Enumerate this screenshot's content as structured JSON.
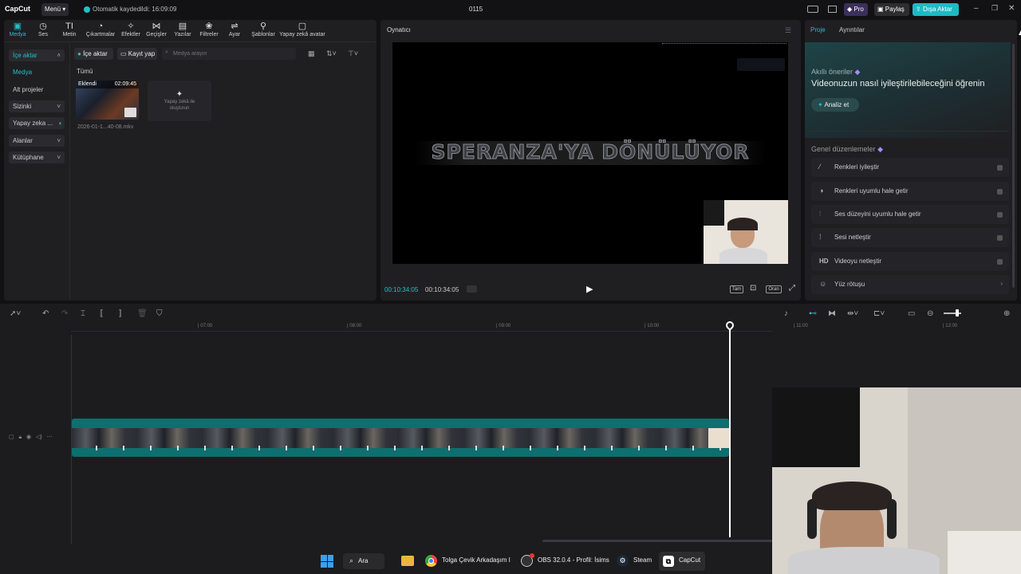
{
  "app": {
    "logo": "CapCut",
    "menu": "Menü",
    "autosave": "Otomatik kaydedildi: 16:09:09",
    "title": "0115",
    "pro": "Pro",
    "share": "Paylaş",
    "export": "Dışa Aktar"
  },
  "toolbar": {
    "items": [
      {
        "label": "Medya",
        "icon": "media-icon"
      },
      {
        "label": "Ses",
        "icon": "audio-icon"
      },
      {
        "label": "Metin",
        "icon": "text-icon"
      },
      {
        "label": "Çıkartmalar",
        "icon": "sticker-icon"
      },
      {
        "label": "Efektler",
        "icon": "effects-icon"
      },
      {
        "label": "Geçişler",
        "icon": "transitions-icon"
      },
      {
        "label": "Yazılar",
        "icon": "captions-icon"
      },
      {
        "label": "Filtreler",
        "icon": "filters-icon"
      },
      {
        "label": "Ayar",
        "icon": "adjust-icon"
      },
      {
        "label": "Şablonlar",
        "icon": "templates-icon"
      },
      {
        "label": "Yapay zekâ avatar",
        "icon": "ai-avatar-icon"
      }
    ]
  },
  "sidebar": {
    "items": [
      "İçe aktar",
      "Medya",
      "Alt projeler",
      "Sizinki",
      "Yapay zeka ...",
      "Alanlar",
      "Kütüphane"
    ]
  },
  "media": {
    "import_btn": "İçe aktar",
    "record_btn": "Kayıt yap",
    "search_placeholder": "Medya arayın",
    "all_label": "Tümü",
    "clip": {
      "badge": "Eklendi",
      "duration": "02:09:45",
      "filename": "2026-01-1...40-08.mkv"
    },
    "ai_create": "Yapay zekâ ile oluşturun"
  },
  "player": {
    "title": "Oynatıcı",
    "overlay_text": "SPERANZA'YA DÖNÜLÜYOR",
    "time_current": "00:10:34:05",
    "time_total": "00:10:34:05",
    "full_btn": "Tam",
    "ratio_btn": "Oran"
  },
  "right_panel": {
    "tab_project": "Proje",
    "tab_details": "Ayrıntılar",
    "smart_title": "Akıllı öneriler",
    "smart_subtitle": "Videonuzun nasıl iyileştirilebileceğini öğrenin",
    "analyze_btn": "Analiz et",
    "general_title": "Genel düzenlemeler",
    "items": [
      "Renkleri iyileştir",
      "Renkleri uyumlu hale getir",
      "Ses düzeyini uyumlu hale getir",
      "Sesi netleştir",
      "Videoyu netleştir",
      "Yüz rötuşu"
    ]
  },
  "timeline": {
    "ruler": [
      "07:00",
      "08:00",
      "09:00",
      "10:00",
      "11:00",
      "12:00"
    ]
  },
  "taskbar": {
    "search": "Ara",
    "chrome": "Tolga Çevik Arkadaşım I",
    "obs": "OBS 32.0.4 - Profil: İsims",
    "steam": "Steam",
    "capcut": "CapCut"
  },
  "colors": {
    "accent": "#22c0c9",
    "clip_teal": "#0f6e6e",
    "export": "#1fb9c4"
  }
}
